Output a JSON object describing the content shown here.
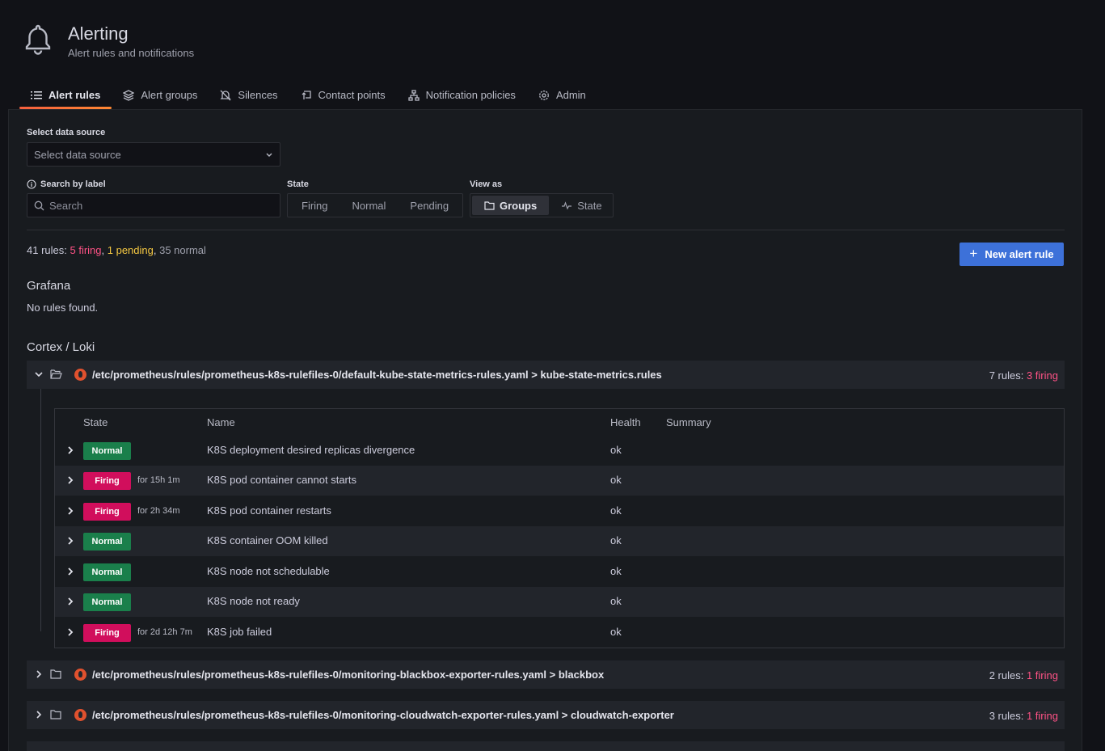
{
  "header": {
    "title": "Alerting",
    "subtitle": "Alert rules and notifications"
  },
  "tabs": [
    {
      "label": "Alert rules",
      "icon": "list-icon",
      "active": true
    },
    {
      "label": "Alert groups",
      "icon": "layers-icon"
    },
    {
      "label": "Silences",
      "icon": "bell-slash-icon"
    },
    {
      "label": "Contact points",
      "icon": "comment-arrow-icon"
    },
    {
      "label": "Notification policies",
      "icon": "sitemap-icon"
    },
    {
      "label": "Admin",
      "icon": "gear-icon"
    }
  ],
  "filters": {
    "datasource_label": "Select data source",
    "datasource_placeholder": "Select data source",
    "search_label": "Search by label",
    "search_placeholder": "Search",
    "state_label": "State",
    "state_options": [
      "Firing",
      "Normal",
      "Pending"
    ],
    "view_label": "View as",
    "view_options": [
      "Groups",
      "State"
    ],
    "view_selected": "Groups"
  },
  "summary": {
    "total": "41 rules: ",
    "firing": "5 firing",
    "sep1": ", ",
    "pending": "1 pending",
    "sep2": ", ",
    "normal": "35 normal"
  },
  "new_rule_button": "New alert rule",
  "sections": {
    "grafana": {
      "title": "Grafana",
      "empty": "No rules found."
    },
    "cortex": {
      "title": "Cortex / Loki"
    }
  },
  "groups": [
    {
      "name": "/etc/prometheus/rules/prometheus-k8s-rulefiles-0/default-kube-state-metrics-rules.yaml > kube-state-metrics.rules",
      "count": "7 rules: ",
      "firing": "3 firing",
      "expanded": true
    },
    {
      "name": "/etc/prometheus/rules/prometheus-k8s-rulefiles-0/monitoring-blackbox-exporter-rules.yaml > blackbox",
      "count": "2 rules: ",
      "firing": "1 firing",
      "expanded": false
    },
    {
      "name": "/etc/prometheus/rules/prometheus-k8s-rulefiles-0/monitoring-cloudwatch-exporter-rules.yaml > cloudwatch-exporter",
      "count": "3 rules: ",
      "firing": "1 firing",
      "expanded": false
    }
  ],
  "table": {
    "headers": {
      "state": "State",
      "name": "Name",
      "health": "Health",
      "summary": "Summary"
    },
    "rows": [
      {
        "state": "Normal",
        "for": "",
        "name": "K8S deployment desired replicas divergence",
        "health": "ok"
      },
      {
        "state": "Firing",
        "for": "for 15h 1m",
        "name": "K8S pod container cannot starts",
        "health": "ok"
      },
      {
        "state": "Firing",
        "for": "for 2h 34m",
        "name": "K8S pod container restarts",
        "health": "ok"
      },
      {
        "state": "Normal",
        "for": "",
        "name": "K8S container OOM killed",
        "health": "ok"
      },
      {
        "state": "Normal",
        "for": "",
        "name": "K8S node not schedulable",
        "health": "ok"
      },
      {
        "state": "Normal",
        "for": "",
        "name": "K8S node not ready",
        "health": "ok"
      },
      {
        "state": "Firing",
        "for": "for 2d 12h 7m",
        "name": "K8S job failed",
        "health": "ok"
      }
    ]
  },
  "colors": {
    "firing": "#ff5286",
    "pending": "#f5c842",
    "badge_normal": "#1a7f4b",
    "badge_firing": "#d10e5c",
    "primary_button": "#3d71d9"
  }
}
